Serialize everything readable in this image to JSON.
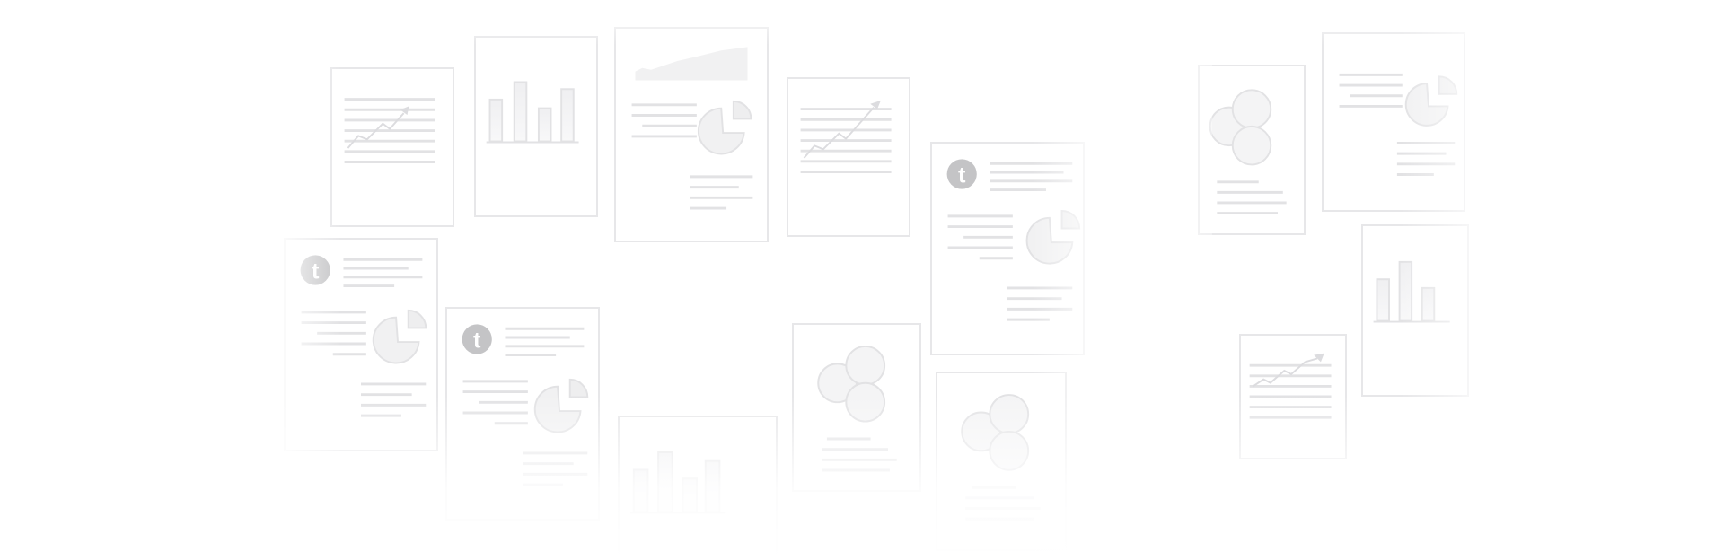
{
  "background": {
    "color": "#ffffff"
  },
  "colors": {
    "card_border": "#e7e7e9",
    "line": "#e2e2e4",
    "shape_fill": "#f1f1f2",
    "shape_stroke": "#e2e2e4",
    "logo": "#c4c4c6"
  },
  "logo": {
    "letter": "t"
  },
  "cards": [
    {
      "kind": "line-chart-doc"
    },
    {
      "kind": "bar-chart-doc"
    },
    {
      "kind": "area-pie-doc"
    },
    {
      "kind": "line-chart-doc"
    },
    {
      "kind": "logo-pie-doc"
    },
    {
      "kind": "venn-doc"
    },
    {
      "kind": "pie-doc"
    },
    {
      "kind": "logo-pie-doc"
    },
    {
      "kind": "logo-pie-doc"
    },
    {
      "kind": "bar-chart-doc"
    },
    {
      "kind": "venn-doc"
    },
    {
      "kind": "venn-doc"
    },
    {
      "kind": "bar-chart-doc"
    },
    {
      "kind": "line-chart-doc"
    }
  ]
}
